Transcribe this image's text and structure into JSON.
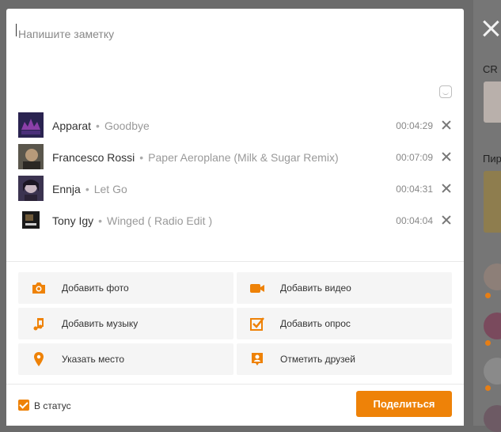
{
  "background": {
    "labels": [
      "CR",
      "Пир"
    ],
    "accent_color": "#ee8208"
  },
  "composer": {
    "placeholder": "Напишите заметку"
  },
  "tracks": [
    {
      "artist": "Apparat",
      "title": "Goodbye",
      "duration": "00:04:29"
    },
    {
      "artist": "Francesco Rossi",
      "title": "Paper Aeroplane (Milk & Sugar Remix)",
      "duration": "00:07:09"
    },
    {
      "artist": "Ennja",
      "title": "Let Go",
      "duration": "00:04:31"
    },
    {
      "artist": "Tony Igy",
      "title": "Winged ( Radio Edit )",
      "duration": "00:04:04"
    }
  ],
  "actions": [
    {
      "label": "Добавить фото",
      "icon": "camera-icon"
    },
    {
      "label": "Добавить видео",
      "icon": "video-camera-icon"
    },
    {
      "label": "Добавить музыку",
      "icon": "music-note-icon"
    },
    {
      "label": "Добавить опрос",
      "icon": "poll-checkbox-icon"
    },
    {
      "label": "Указать место",
      "icon": "location-pin-icon"
    },
    {
      "label": "Отметить друзей",
      "icon": "tag-friends-icon"
    }
  ],
  "footer": {
    "status_label": "В статус",
    "status_checked": true,
    "share_label": "Поделиться"
  }
}
